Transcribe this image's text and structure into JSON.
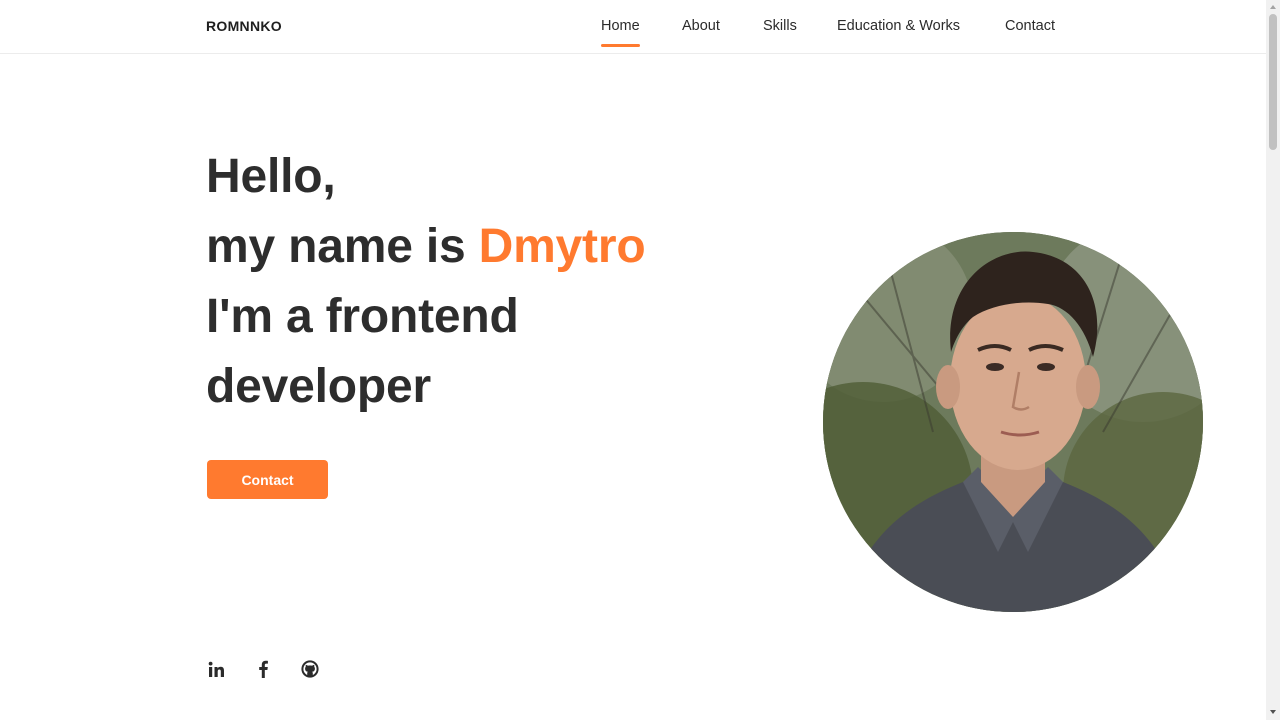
{
  "brand": {
    "logo_text": "ROMNNKO",
    "accent_color": "#ff7a2f"
  },
  "nav": {
    "items": [
      {
        "label": "Home",
        "active": true
      },
      {
        "label": "About",
        "active": false
      },
      {
        "label": "Skills",
        "active": false
      },
      {
        "label": "Education & Works",
        "active": false
      },
      {
        "label": "Contact",
        "active": false
      }
    ]
  },
  "hero": {
    "line1": "Hello,",
    "line2_prefix": "my name is ",
    "name": "Dmytro",
    "line3": "I'm a frontend",
    "line4": "developer",
    "cta_label": "Contact"
  },
  "profile_photo": {
    "icon": "portrait-photo"
  },
  "social": [
    {
      "icon": "linkedin-icon",
      "label": "in"
    },
    {
      "icon": "facebook-icon",
      "label": "f"
    },
    {
      "icon": "github-icon",
      "label": "github"
    }
  ]
}
